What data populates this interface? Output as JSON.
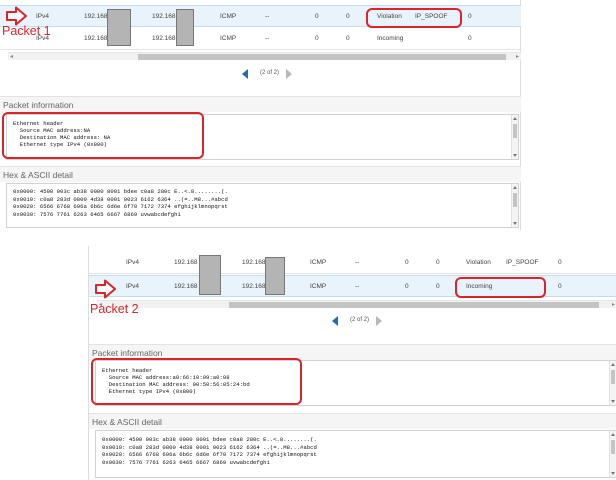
{
  "packet1": {
    "label": "Packet 1",
    "rows": [
      {
        "proto": "IPv4",
        "src": "192.168",
        "dst": "192.168",
        "type": "ICMP",
        "port": "--",
        "n1": "0",
        "n2": "0",
        "dir": "Violation",
        "reason": "IP_SPOOF",
        "n3": "0"
      },
      {
        "proto": "IPv4",
        "src": "192.168",
        "dst": "192.168",
        "type": "ICMP",
        "port": "--",
        "n1": "0",
        "n2": "0",
        "dir": "Incoming",
        "reason": "",
        "n3": "0"
      }
    ],
    "pager": "(2 of 2)",
    "packet_info_title": "Packet information",
    "packet_info_lines": [
      "Ethernet header",
      "  Source MAC address:NA",
      "  Destination MAC address: NA",
      "  Ethernet type IPv4 (0x800)"
    ],
    "hex_title": "Hex & ASCII detail",
    "hex_lines": [
      "0x0000: 4500 003c ab38 0000 8001 bdee c0a8 280c E..<.8........(.",
      "0x0010: c0a8 283d 0800 4d38 0001 0023 6162 6364 ..(=..M8...#abcd",
      "0x0020: 6566 6768 696a 6b6c 6d6e 6f70 7172 7374 efghijklmnopqrst",
      "0x0030: 7576 7761 6263 6465 6667 6869 uvwabcdefghi"
    ]
  },
  "packet2": {
    "label": "Packet 2",
    "rows": [
      {
        "proto": "IPv4",
        "src": "192.168",
        "dst": "192.168",
        "type": "ICMP",
        "port": "--",
        "n1": "0",
        "n2": "0",
        "dir": "Violation",
        "reason": "IP_SPOOF",
        "n3": "0"
      },
      {
        "proto": "IPv4",
        "src": "192.168",
        "dst": "192.168",
        "type": "ICMP",
        "port": "--",
        "n1": "0",
        "n2": "0",
        "dir": "Incoming",
        "reason": "",
        "n3": "0"
      }
    ],
    "pager": "(2 of 2)",
    "packet_info_title": "Packet information",
    "packet_info_lines": [
      "Ethernet header",
      "  Source MAC address:a0:66:10:09:a0:08",
      "  Destination MAC address: 00:50:56:85:24:bd",
      "  Ethernet type IPv4 (0x800)"
    ],
    "hex_title": "Hex & ASCII detail",
    "hex_lines": [
      "0x0000: 4500 003c ab38 0000 8001 bdee c0a8 280c E..<.8........(.",
      "0x0010: c0a8 283d 0800 4d38 0001 0023 6162 6364 ..(=..M8...#abcd",
      "0x0020: 6566 6768 696a 6b6c 6d6e 6f70 7172 7374 efghijklmnopqrst",
      "0x0030: 7576 7761 6263 6465 6667 6869 uvwabcdefghi"
    ]
  },
  "colors": {
    "highlight": "#d9242b",
    "selected_row": "#e9f3fb",
    "pager_active": "#1f6db5"
  }
}
